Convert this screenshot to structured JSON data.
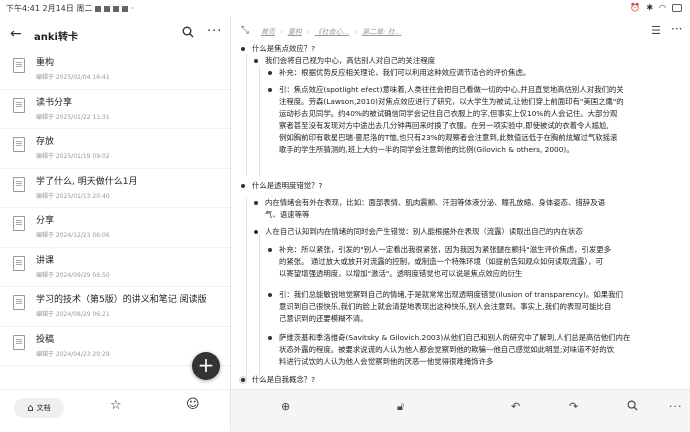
{
  "status": {
    "time": "下午4:41 2月14日 周二",
    "right_icons": [
      "alarm-icon",
      "bluetooth-icon",
      "wifi-icon",
      "battery-icon"
    ]
  },
  "left": {
    "title": "anki转卡",
    "items": [
      {
        "title": "重构",
        "meta": "编辑于 2025/02/04 16:41"
      },
      {
        "title": "读书分享",
        "meta": "编辑于 2025/01/22 11:31"
      },
      {
        "title": "存放",
        "meta": "编辑于 2025/01/19 09:02"
      },
      {
        "title": "学了什么, 明天做什么1月",
        "meta": "编辑于 2025/01/13 20:40"
      },
      {
        "title": "分享",
        "meta": "编辑于 2024/12/23 06:06"
      },
      {
        "title": "讲课",
        "meta": "编辑于 2024/09/29 06:50"
      },
      {
        "title": "学习的技术（第5版）的讲义和笔记 阅读版",
        "meta": "编辑于 2024/08/29 06:21"
      },
      {
        "title": "投稿",
        "meta": "编辑于 2024/04/23 20:29"
      }
    ],
    "nav": {
      "home_label": "文档"
    }
  },
  "right": {
    "breadcrumb": [
      "首页",
      "重构",
      "《社会心...",
      "第二章: 社..."
    ],
    "lines": {
      "h1": "什么是焦点效应？?",
      "b1": "我们会将自己视为中心，高估别人对自己的关注程度",
      "b1a": "补充：根据优势反应相关理论，我们可以利用这种效应调节适合的评价焦虑。",
      "b1b_1": "引：焦点效应(spotlight efect)意味着,人类往往会把自己看做一切的中心,并且直觉地高估别人对我们的关",
      "b1b_2": "注程度。劳森(Lawson,2010)对焦点效应进行了研究，以大学生为被试,让他们穿上前面印有\"美国之鹰\"的",
      "b1b_3": "运动衫去见同学。约40%的被试确信同学会记住自己衣服上的字,但事实上仅10%的人会记住。大部分观",
      "b1b_4": "察者甚至没有发现对方中途出去几分钟再回来时换了衣服。在另一项实验中,即使被试的衣着令人尴尬,",
      "b1b_5": "例如胸前印有歌星巴瑞·曼尼洛的T恤,也只有23%的观察者会注意到,此数值远低于在胸前炫耀过气软摇滚",
      "b1b_6": "歌手的学生所猜测的,班上大约一半的同学会注意到他的比例(Gilovich & others, 2000)。",
      "h2": "什么是透明度错觉？?",
      "b2_1": "内在情绪会有外在表现，比如：面部表情、肌肉震颤、汗泪等体液分泌、瞳孔放缩、身体姿态、措辞及语",
      "b2_2": "气、语速等等",
      "b3": "人在自己认知到内在情绪的同时会产生错觉：别人能根据外在表现（流露）读取出自己的内在状态",
      "b3a_1": "补充：所以紧张，引发的\"别人一定看出我很紧张，因为我因为紧张腿在颤抖\"滋生评价焦虑，引发更多",
      "b3a_2": "的紧张。  通过放大或放开对流露的控制，或制造一个特殊环境（如提前告知观众如何读取流露），可",
      "b3a_3": "以寄望增强透明度，以增加\"激活\"。透明度错觉也可以说是焦点效应的衍生",
      "b3b_1": "引：我们总能敏锐地觉察到自己的情绪,于是就常常出现透明度错觉(ilusion of transparency)。如果我们",
      "b3b_2": "意识到自己很快乐,我们的脸上就会清楚地表现出这种快乐,别人会注意到。事实上,我们的表现可能比自",
      "b3b_3": "己意识到的还要模糊不清。",
      "b3c_1": "萨维茨基和季洛维奇(Savitsky & Gilovich.2003)从他们自己和别人的研究中了解到,人们总是高估他们内在",
      "b3c_2": "状态外露的程度。被要求说谎的人认为他人都会觉察到他的欺骗—他自己感觉如此明显;对味道不好的饮",
      "b3c_3": "料进行试饮的人认为他人会觉察到他的厌恶一他觉得很难掩饰许多",
      "h3": "什么是自我概念？?"
    },
    "toolbar": [
      "add-icon",
      "unlock-icon",
      "undo-icon",
      "redo-icon",
      "search-icon",
      "more-icon"
    ]
  }
}
